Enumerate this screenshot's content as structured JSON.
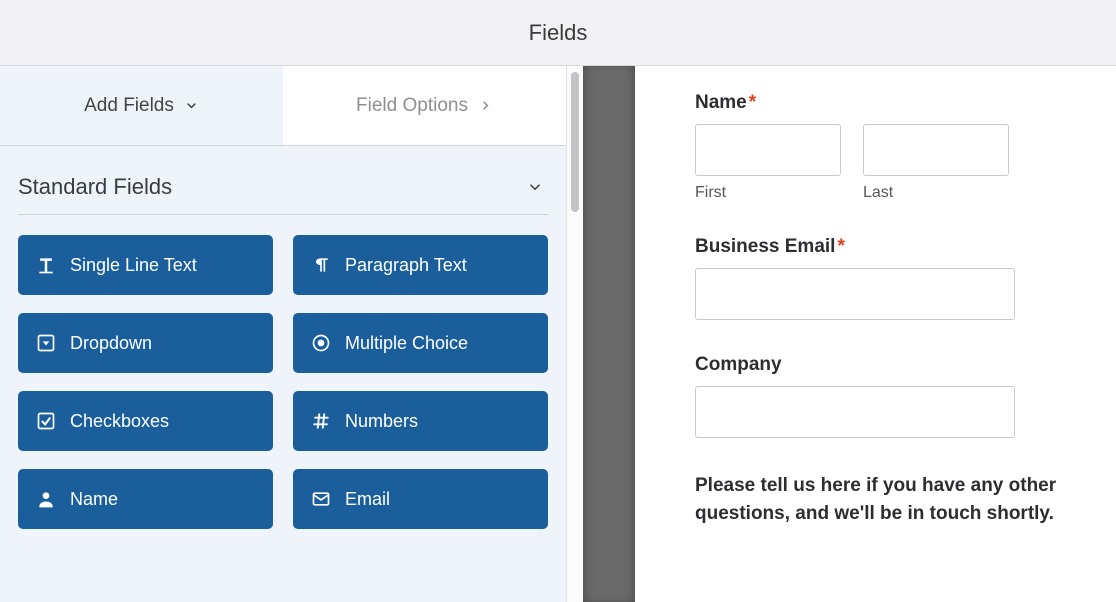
{
  "header": {
    "title": "Fields"
  },
  "tabs": {
    "add_fields": "Add Fields",
    "field_options": "Field Options"
  },
  "section": {
    "title": "Standard Fields"
  },
  "fields": {
    "single_line": "Single Line Text",
    "paragraph": "Paragraph Text",
    "dropdown": "Dropdown",
    "multiple_choice": "Multiple Choice",
    "checkboxes": "Checkboxes",
    "numbers": "Numbers",
    "name": "Name",
    "email": "Email"
  },
  "preview": {
    "name_label": "Name",
    "first": "First",
    "last": "Last",
    "email_label": "Business Email",
    "company_label": "Company",
    "prompt": "Please tell us here if you have any other questions, and we'll be in touch shortly."
  },
  "required_mark": "*"
}
